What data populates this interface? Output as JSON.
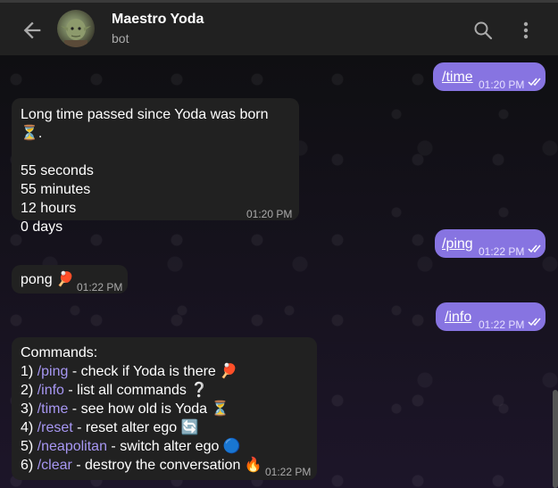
{
  "header": {
    "title": "Maestro Yoda",
    "subtitle": "bot"
  },
  "messages": {
    "m1": {
      "text": "/time",
      "time": "01:20 PM"
    },
    "m2": {
      "line1": "Long time passed since Yoda was born ⏳.",
      "line2": "55 seconds",
      "line3": "55 minutes",
      "line4": "12 hours",
      "line5": "0 days",
      "time": "01:20 PM"
    },
    "m3": {
      "text": "/ping",
      "time": "01:22 PM"
    },
    "m4": {
      "text": "pong 🏓",
      "time": "01:22 PM"
    },
    "m5": {
      "text": "/info",
      "time": "01:22 PM"
    },
    "m6": {
      "heading": "Commands:",
      "items": [
        {
          "num": "1)",
          "cmd": "/ping",
          "desc": " - check if Yoda is there 🏓"
        },
        {
          "num": "2)",
          "cmd": "/info",
          "desc": " - list all commands  ❔"
        },
        {
          "num": "3)",
          "cmd": "/time",
          "desc": " - see how old is Yoda ⏳"
        },
        {
          "num": "4)",
          "cmd": "/reset",
          "desc": " - reset alter ego 🔄"
        },
        {
          "num": "5)",
          "cmd": "/neapolitan",
          "desc": " - switch alter ego 🔵"
        },
        {
          "num": "6)",
          "cmd": "/clear",
          "desc": " - destroy the conversation 🔥"
        }
      ],
      "time": "01:22 PM"
    }
  },
  "colors": {
    "accent": "#8774e1",
    "incoming": "#212121",
    "link": "#a797f3",
    "header": "#212121"
  },
  "icons": {
    "back": "arrow-left-icon",
    "search": "search-icon",
    "more": "more-vert-icon",
    "read": "double-check-icon"
  }
}
